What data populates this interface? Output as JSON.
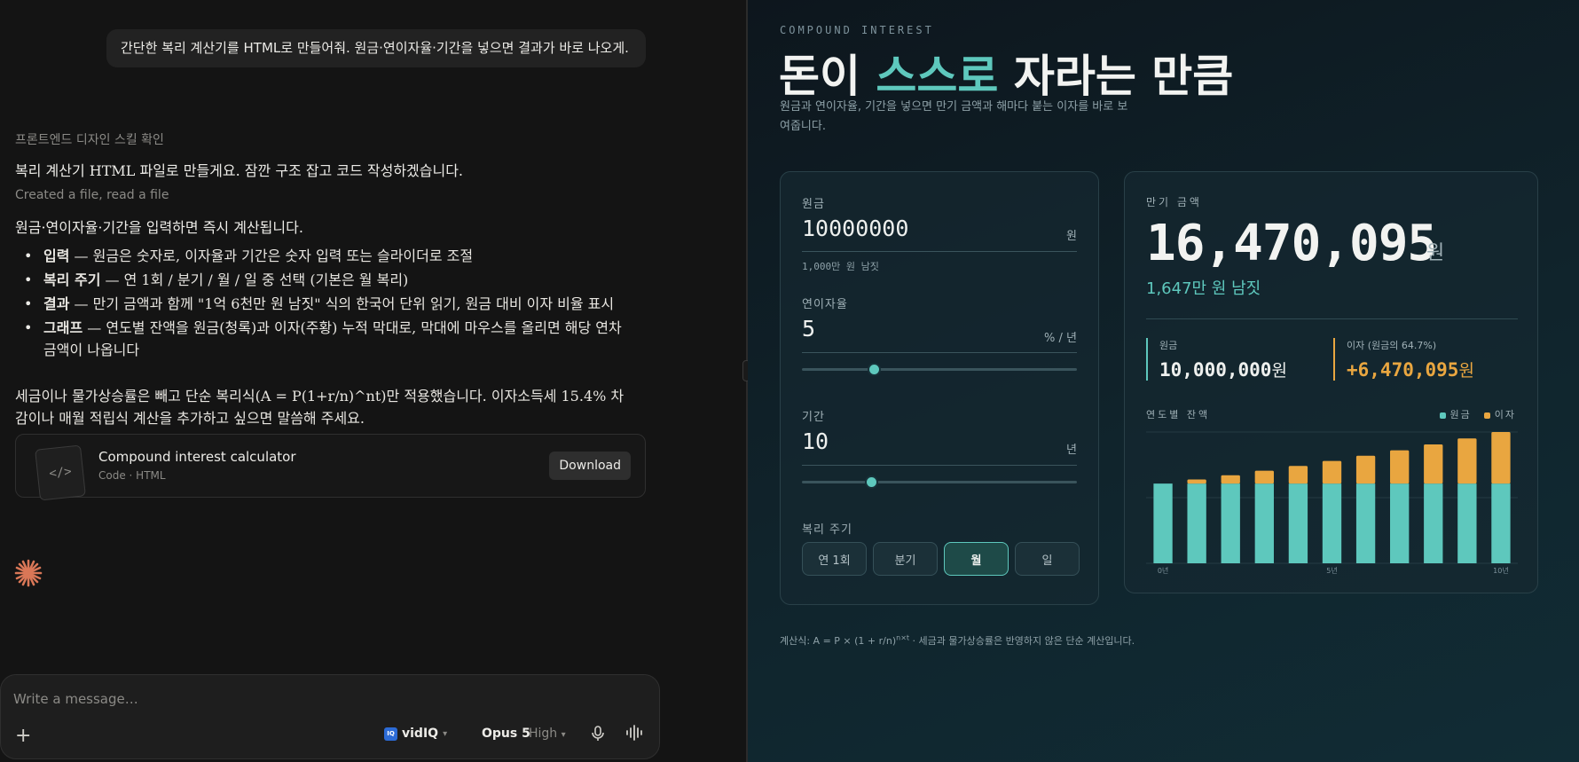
{
  "chat": {
    "user_message": "간단한 복리 계산기를 HTML로 만들어줘. 원금·연이자율·기간을 넣으면 결과가 바로 나오게.",
    "step_label": "프론트엔드 디자인 스킬 확인",
    "reply_line": "복리 계산기 HTML 파일로 만들게요. 잠깐 구조 잡고 코드 작성하겠습니다.",
    "file_note": "Created a file, read a file",
    "summary_line": "원금·연이자율·기간을 입력하면 즉시 계산됩니다.",
    "points": [
      {
        "bold": "입력",
        "text": " — 원금은 숫자로, 이자율과 기간은 숫자 입력 또는 슬라이더로 조절"
      },
      {
        "bold": "복리 주기",
        "text": " — 연 1회 / 분기 / 월 / 일 중 선택 (기본은 월 복리)"
      },
      {
        "bold": "결과",
        "text": " — 만기 금액과 함께 \"1억 6천만 원 남짓\" 식의 한국어 단위 읽기, 원금 대비 이자 비율 표시"
      },
      {
        "bold": "그래프",
        "text": " — 연도별 잔액을 원금(청록)과 이자(주황) 누적 막대로, 막대에 마우스를 올리면 해당 연차 금액이 나옵니다"
      }
    ],
    "note": "세금이나 물가상승률은 빼고 단순 복리식(A = P(1+r/n)^nt)만 적용했습니다. 이자소득세 15.4% 차감이나 매월 적립식 계산을 추가하고 싶으면 말씀해 주세요.",
    "file_card": {
      "title": "Compound interest calculator",
      "subtitle": "Code · HTML",
      "download_label": "Download"
    },
    "composer": {
      "placeholder": "Write a message…",
      "plus": "+",
      "vidiq": "vidIQ",
      "vidiq_logo": "IQ",
      "model": "Opus 5",
      "effort": "High"
    }
  },
  "calc": {
    "eyebrow": "COMPOUND INTEREST",
    "headline_pre": "돈이 ",
    "headline_accent": "스스로",
    "headline_post": " 자라는 만큼",
    "subtitle": "원금과 연이자율, 기간을 넣으면 만기 금액과 해마다 붙는 이자를 바로 보여줍니다.",
    "principal": {
      "label": "원금",
      "value": "10000000",
      "unit": "원",
      "hint": "1,000만 원 남짓"
    },
    "rate": {
      "label": "연이자율",
      "value": "5",
      "unit": "% / 년",
      "slider_fraction": 0.26
    },
    "period": {
      "label": "기간",
      "value": "10",
      "unit": "년",
      "slider_fraction": 0.25
    },
    "frequency": {
      "label": "복리 주기",
      "options": [
        "연 1회",
        "분기",
        "월",
        "일"
      ],
      "selected": "월"
    },
    "result": {
      "label": "만기 금액",
      "total": "16,470,095",
      "total_unit": "원",
      "korean": "1,647만 원 남짓",
      "principal_label": "원금",
      "principal_value": "10,000,000",
      "principal_unit": "원",
      "interest_label": "이자 (원금의 64.7%)",
      "interest_value": "+6,470,095",
      "interest_unit": "원"
    },
    "formula_prefix": "계산식: A = P × (1 + r/n)",
    "formula_sup": "n×t",
    "formula_suffix": " · 세금과 물가상승률은 반영하지 않은 단순 계산입니다."
  },
  "chart_data": {
    "type": "bar",
    "title": "연도별 잔액",
    "categories": [
      "0년",
      "1년",
      "2년",
      "3년",
      "4년",
      "5년",
      "6년",
      "7년",
      "8년",
      "9년",
      "10년"
    ],
    "tick_labels_shown": [
      "0년",
      "5년",
      "10년"
    ],
    "stacked": true,
    "series": [
      {
        "name": "원금",
        "values": [
          10000000,
          10000000,
          10000000,
          10000000,
          10000000,
          10000000,
          10000000,
          10000000,
          10000000,
          10000000,
          10000000
        ],
        "color": "#5ec8bd"
      },
      {
        "name": "이자",
        "values": [
          0,
          511619,
          1049413,
          1614722,
          2208963,
          2833587,
          3490162,
          4180313,
          4905770,
          5668352,
          6470095
        ],
        "color": "#e9a640"
      }
    ],
    "ylim": [
      0,
      16470095
    ],
    "legend": "top-right",
    "grid": true
  }
}
